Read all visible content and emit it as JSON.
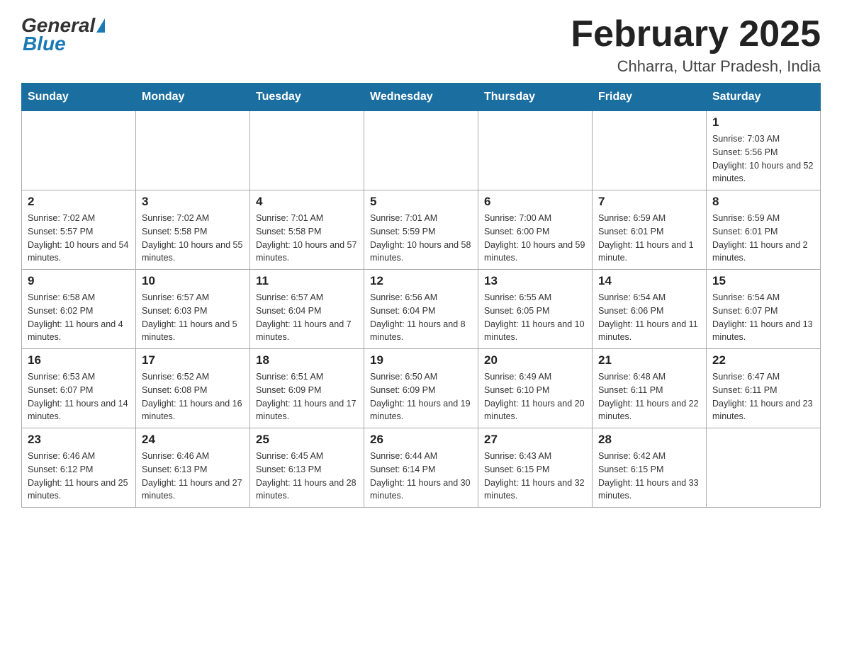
{
  "header": {
    "title": "February 2025",
    "location": "Chharra, Uttar Pradesh, India",
    "logo_general": "General",
    "logo_blue": "Blue"
  },
  "days_of_week": [
    "Sunday",
    "Monday",
    "Tuesday",
    "Wednesday",
    "Thursday",
    "Friday",
    "Saturday"
  ],
  "weeks": [
    [
      {
        "day": "",
        "sunrise": "",
        "sunset": "",
        "daylight": ""
      },
      {
        "day": "",
        "sunrise": "",
        "sunset": "",
        "daylight": ""
      },
      {
        "day": "",
        "sunrise": "",
        "sunset": "",
        "daylight": ""
      },
      {
        "day": "",
        "sunrise": "",
        "sunset": "",
        "daylight": ""
      },
      {
        "day": "",
        "sunrise": "",
        "sunset": "",
        "daylight": ""
      },
      {
        "day": "",
        "sunrise": "",
        "sunset": "",
        "daylight": ""
      },
      {
        "day": "1",
        "sunrise": "Sunrise: 7:03 AM",
        "sunset": "Sunset: 5:56 PM",
        "daylight": "Daylight: 10 hours and 52 minutes."
      }
    ],
    [
      {
        "day": "2",
        "sunrise": "Sunrise: 7:02 AM",
        "sunset": "Sunset: 5:57 PM",
        "daylight": "Daylight: 10 hours and 54 minutes."
      },
      {
        "day": "3",
        "sunrise": "Sunrise: 7:02 AM",
        "sunset": "Sunset: 5:58 PM",
        "daylight": "Daylight: 10 hours and 55 minutes."
      },
      {
        "day": "4",
        "sunrise": "Sunrise: 7:01 AM",
        "sunset": "Sunset: 5:58 PM",
        "daylight": "Daylight: 10 hours and 57 minutes."
      },
      {
        "day": "5",
        "sunrise": "Sunrise: 7:01 AM",
        "sunset": "Sunset: 5:59 PM",
        "daylight": "Daylight: 10 hours and 58 minutes."
      },
      {
        "day": "6",
        "sunrise": "Sunrise: 7:00 AM",
        "sunset": "Sunset: 6:00 PM",
        "daylight": "Daylight: 10 hours and 59 minutes."
      },
      {
        "day": "7",
        "sunrise": "Sunrise: 6:59 AM",
        "sunset": "Sunset: 6:01 PM",
        "daylight": "Daylight: 11 hours and 1 minute."
      },
      {
        "day": "8",
        "sunrise": "Sunrise: 6:59 AM",
        "sunset": "Sunset: 6:01 PM",
        "daylight": "Daylight: 11 hours and 2 minutes."
      }
    ],
    [
      {
        "day": "9",
        "sunrise": "Sunrise: 6:58 AM",
        "sunset": "Sunset: 6:02 PM",
        "daylight": "Daylight: 11 hours and 4 minutes."
      },
      {
        "day": "10",
        "sunrise": "Sunrise: 6:57 AM",
        "sunset": "Sunset: 6:03 PM",
        "daylight": "Daylight: 11 hours and 5 minutes."
      },
      {
        "day": "11",
        "sunrise": "Sunrise: 6:57 AM",
        "sunset": "Sunset: 6:04 PM",
        "daylight": "Daylight: 11 hours and 7 minutes."
      },
      {
        "day": "12",
        "sunrise": "Sunrise: 6:56 AM",
        "sunset": "Sunset: 6:04 PM",
        "daylight": "Daylight: 11 hours and 8 minutes."
      },
      {
        "day": "13",
        "sunrise": "Sunrise: 6:55 AM",
        "sunset": "Sunset: 6:05 PM",
        "daylight": "Daylight: 11 hours and 10 minutes."
      },
      {
        "day": "14",
        "sunrise": "Sunrise: 6:54 AM",
        "sunset": "Sunset: 6:06 PM",
        "daylight": "Daylight: 11 hours and 11 minutes."
      },
      {
        "day": "15",
        "sunrise": "Sunrise: 6:54 AM",
        "sunset": "Sunset: 6:07 PM",
        "daylight": "Daylight: 11 hours and 13 minutes."
      }
    ],
    [
      {
        "day": "16",
        "sunrise": "Sunrise: 6:53 AM",
        "sunset": "Sunset: 6:07 PM",
        "daylight": "Daylight: 11 hours and 14 minutes."
      },
      {
        "day": "17",
        "sunrise": "Sunrise: 6:52 AM",
        "sunset": "Sunset: 6:08 PM",
        "daylight": "Daylight: 11 hours and 16 minutes."
      },
      {
        "day": "18",
        "sunrise": "Sunrise: 6:51 AM",
        "sunset": "Sunset: 6:09 PM",
        "daylight": "Daylight: 11 hours and 17 minutes."
      },
      {
        "day": "19",
        "sunrise": "Sunrise: 6:50 AM",
        "sunset": "Sunset: 6:09 PM",
        "daylight": "Daylight: 11 hours and 19 minutes."
      },
      {
        "day": "20",
        "sunrise": "Sunrise: 6:49 AM",
        "sunset": "Sunset: 6:10 PM",
        "daylight": "Daylight: 11 hours and 20 minutes."
      },
      {
        "day": "21",
        "sunrise": "Sunrise: 6:48 AM",
        "sunset": "Sunset: 6:11 PM",
        "daylight": "Daylight: 11 hours and 22 minutes."
      },
      {
        "day": "22",
        "sunrise": "Sunrise: 6:47 AM",
        "sunset": "Sunset: 6:11 PM",
        "daylight": "Daylight: 11 hours and 23 minutes."
      }
    ],
    [
      {
        "day": "23",
        "sunrise": "Sunrise: 6:46 AM",
        "sunset": "Sunset: 6:12 PM",
        "daylight": "Daylight: 11 hours and 25 minutes."
      },
      {
        "day": "24",
        "sunrise": "Sunrise: 6:46 AM",
        "sunset": "Sunset: 6:13 PM",
        "daylight": "Daylight: 11 hours and 27 minutes."
      },
      {
        "day": "25",
        "sunrise": "Sunrise: 6:45 AM",
        "sunset": "Sunset: 6:13 PM",
        "daylight": "Daylight: 11 hours and 28 minutes."
      },
      {
        "day": "26",
        "sunrise": "Sunrise: 6:44 AM",
        "sunset": "Sunset: 6:14 PM",
        "daylight": "Daylight: 11 hours and 30 minutes."
      },
      {
        "day": "27",
        "sunrise": "Sunrise: 6:43 AM",
        "sunset": "Sunset: 6:15 PM",
        "daylight": "Daylight: 11 hours and 32 minutes."
      },
      {
        "day": "28",
        "sunrise": "Sunrise: 6:42 AM",
        "sunset": "Sunset: 6:15 PM",
        "daylight": "Daylight: 11 hours and 33 minutes."
      },
      {
        "day": "",
        "sunrise": "",
        "sunset": "",
        "daylight": ""
      }
    ]
  ]
}
